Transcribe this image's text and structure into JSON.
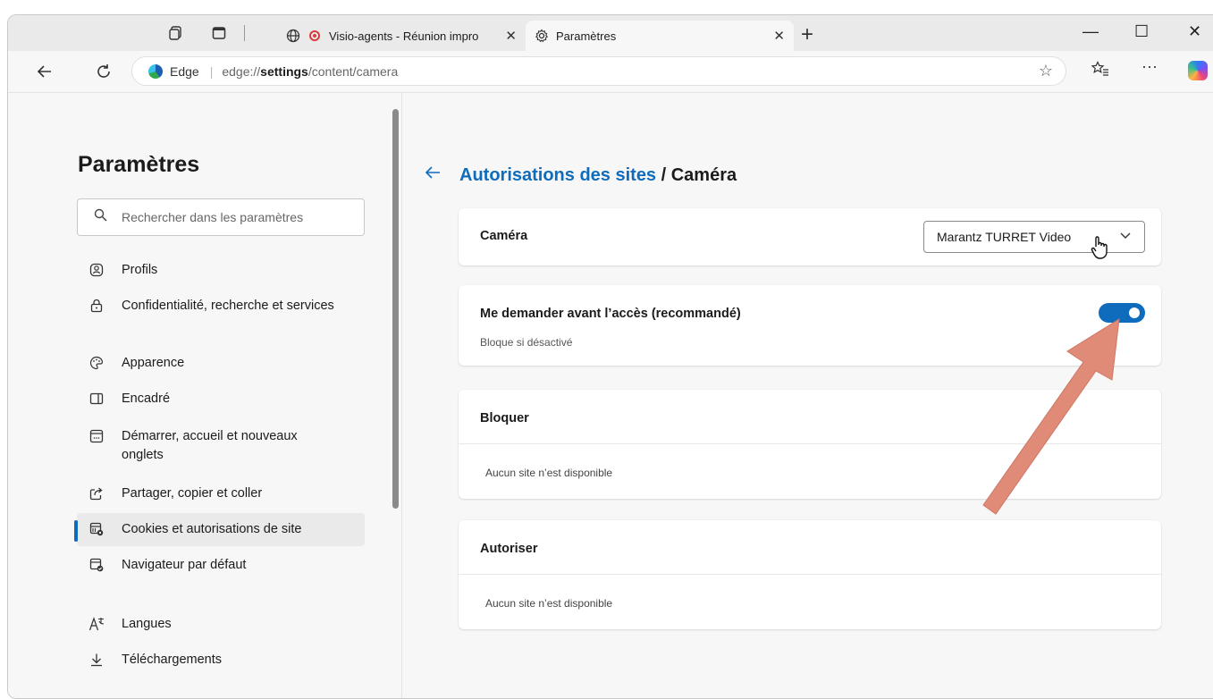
{
  "tabs": {
    "inactive": {
      "title": "Visio-agents - Réunion impro",
      "close": "✕"
    },
    "active": {
      "title": "Paramètres",
      "close": "✕"
    },
    "new_tab": "+"
  },
  "window_controls": {
    "minimize": "—",
    "maximize": "☐",
    "close": "✕"
  },
  "address_bar": {
    "label": "Edge",
    "url_prefix": "edge://",
    "url_bold": "settings",
    "url_suffix": "/content/camera"
  },
  "sidebar": {
    "title": "Paramètres",
    "search_placeholder": "Rechercher dans les paramètres",
    "items": [
      {
        "label": "Profils",
        "icon": "profile-icon"
      },
      {
        "label": "Confidentialité, recherche et services",
        "icon": "lock-icon"
      },
      {
        "label": "Apparence",
        "icon": "palette-icon"
      },
      {
        "label": "Encadré",
        "icon": "sidebar-panel-icon"
      },
      {
        "label": "Démarrer, accueil et nouveaux onglets",
        "icon": "home-tab-icon"
      },
      {
        "label": "Partager, copier et coller",
        "icon": "share-icon"
      },
      {
        "label": "Cookies et autorisations de site",
        "icon": "cookie-settings-icon",
        "selected": true
      },
      {
        "label": "Navigateur par défaut",
        "icon": "default-browser-icon"
      },
      {
        "label": "Langues",
        "icon": "languages-icon"
      },
      {
        "label": "Téléchargements",
        "icon": "download-icon"
      }
    ]
  },
  "main": {
    "breadcrumb_link": "Autorisations des sites",
    "breadcrumb_sep": " / ",
    "breadcrumb_current": "Caméra",
    "camera_card": {
      "label": "Caméra",
      "selected_device": "Marantz TURRET Video"
    },
    "ask_card": {
      "label": "Me demander avant l’accès (recommandé)",
      "sub": "Bloque si désactivé",
      "toggle_on": true
    },
    "block_card": {
      "label": "Bloquer",
      "empty": "Aucun site n’est disponible"
    },
    "allow_card": {
      "label": "Autoriser",
      "empty": "Aucun site n’est disponible"
    }
  },
  "colors": {
    "accent": "#0f6cbd",
    "annotation_arrow": "#e08a78"
  }
}
